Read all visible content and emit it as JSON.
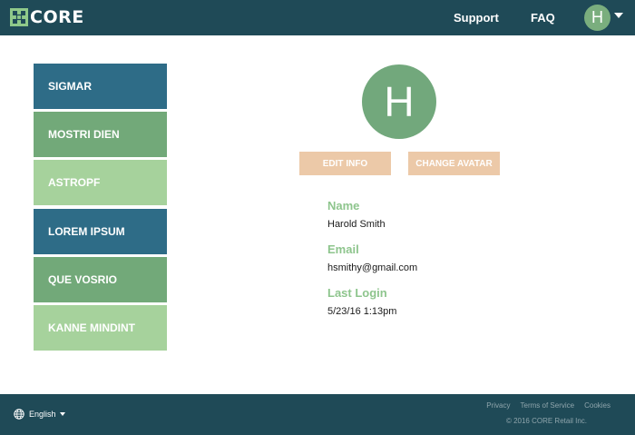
{
  "header": {
    "logo_text": "CORE",
    "nav": {
      "support": "Support",
      "faq": "FAQ"
    },
    "user_initial": "H"
  },
  "sidebar": {
    "items": [
      {
        "label": "SIGMAR",
        "color": "#2e6c87"
      },
      {
        "label": "MOSTRI DIEN",
        "color": "#72a979"
      },
      {
        "label": "ASTROPF",
        "color": "#a6d29c"
      },
      {
        "label": "LOREM IPSUM",
        "color": "#2e6c87"
      },
      {
        "label": "QUE VOSRIO",
        "color": "#72a979"
      },
      {
        "label": "KANNE MINDINT",
        "color": "#a6d29c"
      }
    ]
  },
  "profile": {
    "avatar_initial": "H",
    "buttons": {
      "edit": "EDIT INFO",
      "change_avatar": "CHANGE AVATAR"
    },
    "fields": [
      {
        "label": "Name",
        "value": "Harold Smith"
      },
      {
        "label": "Email",
        "value": "hsmithy@gmail.com"
      },
      {
        "label": "Last Login",
        "value": "5/23/16 1:13pm"
      }
    ]
  },
  "footer": {
    "language": "English",
    "links": {
      "privacy": "Privacy",
      "terms": "Terms of Service",
      "cookies": "Cookies"
    },
    "copyright": "© 2016 CORE Retail Inc."
  },
  "colors": {
    "header_bg": "#1f4a57",
    "accent_green": "#8ec58d",
    "button_peach": "#ecc9a8",
    "avatar_green": "#72a87c"
  }
}
